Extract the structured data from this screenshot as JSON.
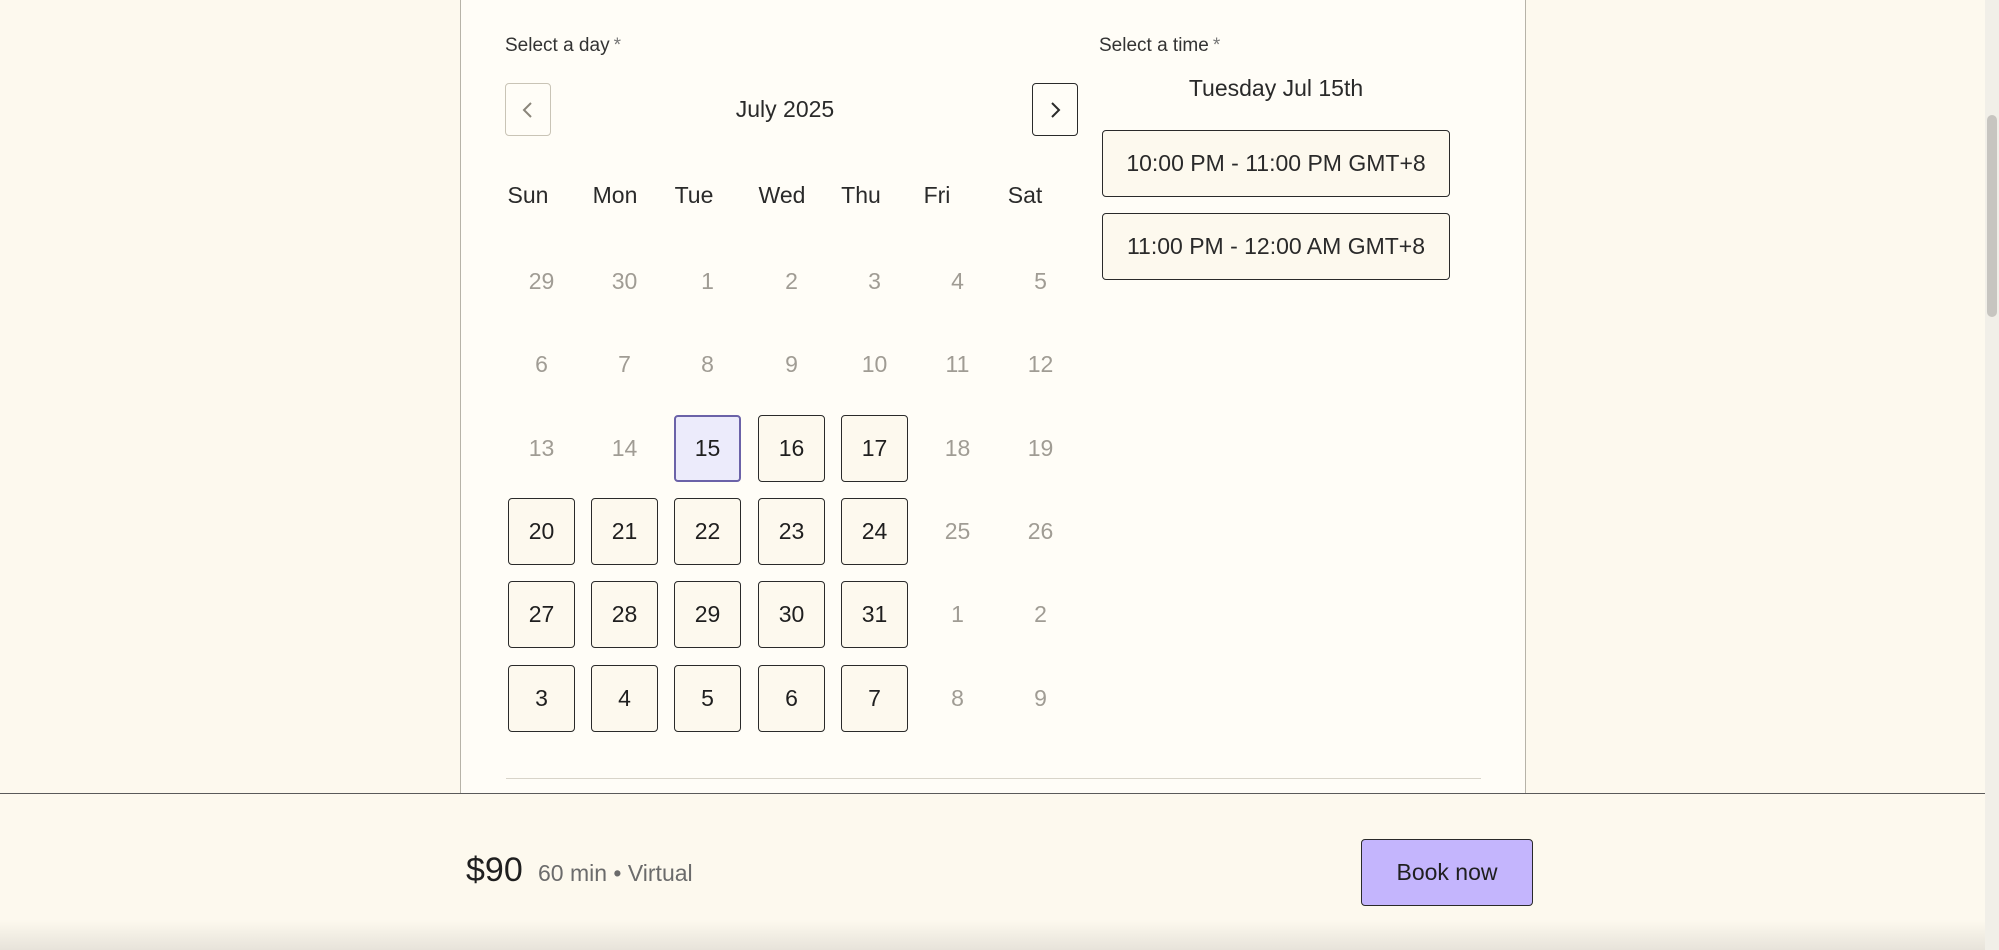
{
  "booking": {
    "day_label": "Select a day",
    "time_label": "Select a time",
    "required_mark": "*",
    "month": "July 2025",
    "weekdays": [
      "Sun",
      "Mon",
      "Tue",
      "Wed",
      "Thu",
      "Fri",
      "Sat"
    ],
    "weeks": [
      [
        {
          "d": "29",
          "s": "muted"
        },
        {
          "d": "30",
          "s": "muted"
        },
        {
          "d": "1",
          "s": "muted"
        },
        {
          "d": "2",
          "s": "muted"
        },
        {
          "d": "3",
          "s": "muted"
        },
        {
          "d": "4",
          "s": "muted"
        },
        {
          "d": "5",
          "s": "muted"
        }
      ],
      [
        {
          "d": "6",
          "s": "muted"
        },
        {
          "d": "7",
          "s": "muted"
        },
        {
          "d": "8",
          "s": "muted"
        },
        {
          "d": "9",
          "s": "muted"
        },
        {
          "d": "10",
          "s": "muted"
        },
        {
          "d": "11",
          "s": "muted"
        },
        {
          "d": "12",
          "s": "muted"
        }
      ],
      [
        {
          "d": "13",
          "s": "muted"
        },
        {
          "d": "14",
          "s": "muted"
        },
        {
          "d": "15",
          "s": "selected"
        },
        {
          "d": "16",
          "s": "avail"
        },
        {
          "d": "17",
          "s": "avail"
        },
        {
          "d": "18",
          "s": "muted"
        },
        {
          "d": "19",
          "s": "muted"
        }
      ],
      [
        {
          "d": "20",
          "s": "avail"
        },
        {
          "d": "21",
          "s": "avail"
        },
        {
          "d": "22",
          "s": "avail"
        },
        {
          "d": "23",
          "s": "avail"
        },
        {
          "d": "24",
          "s": "avail"
        },
        {
          "d": "25",
          "s": "muted"
        },
        {
          "d": "26",
          "s": "muted"
        }
      ],
      [
        {
          "d": "27",
          "s": "avail"
        },
        {
          "d": "28",
          "s": "avail"
        },
        {
          "d": "29",
          "s": "avail"
        },
        {
          "d": "30",
          "s": "avail"
        },
        {
          "d": "31",
          "s": "avail"
        },
        {
          "d": "1",
          "s": "muted"
        },
        {
          "d": "2",
          "s": "muted"
        }
      ],
      [
        {
          "d": "3",
          "s": "avail"
        },
        {
          "d": "4",
          "s": "avail"
        },
        {
          "d": "5",
          "s": "avail"
        },
        {
          "d": "6",
          "s": "avail"
        },
        {
          "d": "7",
          "s": "avail"
        },
        {
          "d": "8",
          "s": "muted"
        },
        {
          "d": "9",
          "s": "muted"
        }
      ]
    ],
    "selected_date": "Tuesday Jul 15th",
    "time_slots": [
      "10:00 PM - 11:00 PM GMT+8",
      "11:00 PM - 12:00 AM GMT+8"
    ]
  },
  "footer": {
    "price": "$90",
    "meta": "60 min • Virtual",
    "book_label": "Book now"
  },
  "icons": {
    "prev": "chevron-left-icon",
    "next": "chevron-right-icon"
  },
  "colors": {
    "background": "#fdf9ee",
    "accent": "#c4b5fd",
    "selected_day_fill": "#ecebfb",
    "selected_day_border": "#6b62a8"
  }
}
